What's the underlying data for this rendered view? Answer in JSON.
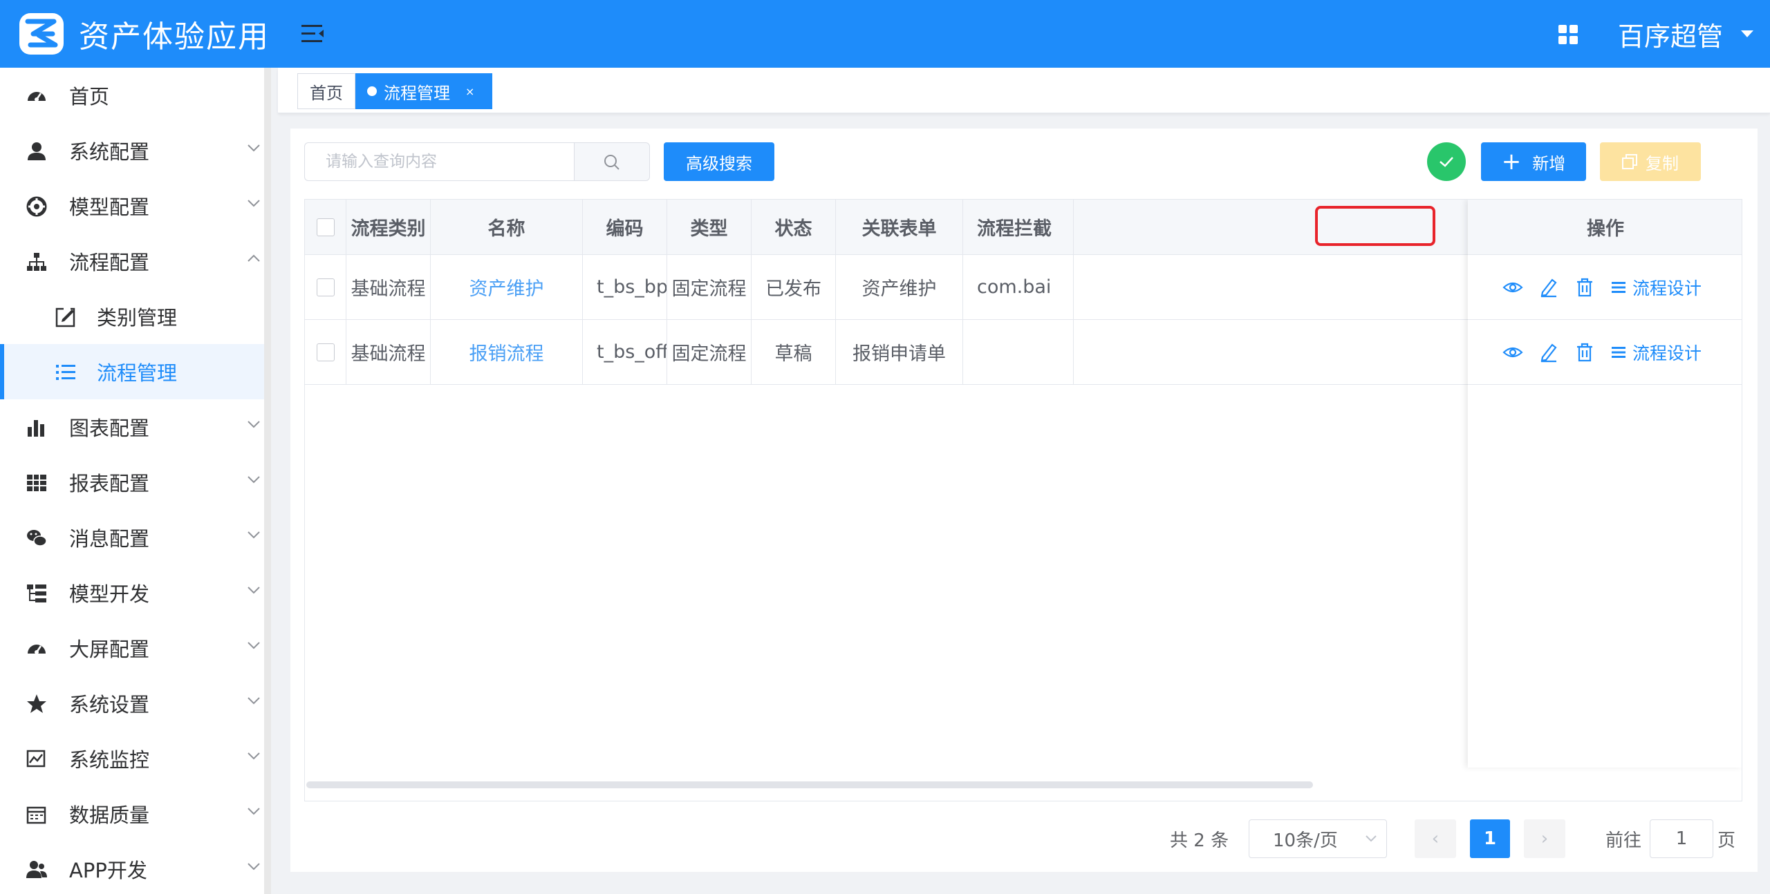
{
  "app": {
    "title": "资产体验应用",
    "user": "百序超管"
  },
  "sidebar": {
    "items": [
      {
        "label": "首页",
        "icon": "dashboard-icon",
        "has_children": false
      },
      {
        "label": "系统配置",
        "icon": "user-icon",
        "has_children": true
      },
      {
        "label": "模型配置",
        "icon": "life-ring-icon",
        "has_children": true
      },
      {
        "label": "流程配置",
        "icon": "sitemap-icon",
        "has_children": true,
        "expanded": true
      },
      {
        "label": "类别管理",
        "icon": "edit-icon",
        "sub": true
      },
      {
        "label": "流程管理",
        "icon": "list-icon",
        "sub": true,
        "active": true
      },
      {
        "label": "图表配置",
        "icon": "bar-chart-icon",
        "has_children": true
      },
      {
        "label": "报表配置",
        "icon": "table-icon",
        "has_children": true
      },
      {
        "label": "消息配置",
        "icon": "wechat-icon",
        "has_children": true
      },
      {
        "label": "模型开发",
        "icon": "tree-list-icon",
        "has_children": true
      },
      {
        "label": "大屏配置",
        "icon": "dashboard-icon",
        "has_children": true
      },
      {
        "label": "系统设置",
        "icon": "star-icon",
        "has_children": true
      },
      {
        "label": "系统监控",
        "icon": "monitor-icon",
        "has_children": true
      },
      {
        "label": "数据质量",
        "icon": "calendar-icon",
        "has_children": true
      },
      {
        "label": "APP开发",
        "icon": "users-icon",
        "has_children": true
      }
    ]
  },
  "tabs": {
    "home": "首页",
    "current": "流程管理",
    "close": "×"
  },
  "toolbar": {
    "search_placeholder": "请输入查询内容",
    "advanced_search": "高级搜索",
    "add": "新增",
    "add_plus": "+",
    "copy": "复制"
  },
  "table": {
    "headers": [
      "流程类别",
      "名称",
      "编码",
      "类型",
      "状态",
      "关联表单",
      "流程拦截",
      "操作"
    ],
    "rows": [
      {
        "category": "基础流程",
        "name": "资产维护",
        "code": "t_bs_bpm...",
        "type": "固定流程",
        "status": "已发布",
        "form": "资产维护",
        "interceptor": "com.bai",
        "design": "流程设计"
      },
      {
        "category": "基础流程",
        "name": "报销流程",
        "code": "t_bs_offer...",
        "type": "固定流程",
        "status": "草稿",
        "form": "报销申请单",
        "interceptor": "",
        "design": "流程设计"
      }
    ]
  },
  "pagination": {
    "total": "共 2 条",
    "page_size": "10条/页",
    "prev": "‹",
    "current": "1",
    "next": "›",
    "goto_label": "前往",
    "goto_value": "1",
    "page_unit": "页"
  },
  "colors": {
    "primary": "#1e8cfa",
    "success": "#29c66b",
    "warning_light": "#fde3a0",
    "highlight": "#e8242b"
  }
}
